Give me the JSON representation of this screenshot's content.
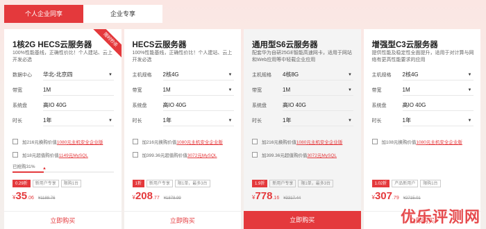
{
  "tabs": [
    "个人企业同享",
    "企业专享"
  ],
  "cards": [
    {
      "title": "1核2G HECS云服务器",
      "desc": "100%性能基线，正确性价比！个人建站、云上开发必选",
      "ribbon": "限时秒杀",
      "rows": [
        {
          "label": "数据中心",
          "value": "华北-北京四",
          "dropdown": true
        },
        {
          "label": "带宽",
          "value": "1M",
          "dropdown": false
        },
        {
          "label": "系统盘",
          "value": "高IO 40G",
          "dropdown": false
        },
        {
          "label": "时长",
          "value": "1年",
          "dropdown": true
        }
      ],
      "checks": [
        {
          "pre": "加216元换购价值",
          "hl": "1080元主机安全企业版"
        },
        {
          "pre": "加18元超值购价值",
          "hl": "1149元MySQL"
        }
      ],
      "progress_text": "已抢购31%",
      "progress": 0.31,
      "tags": [
        "0.29折",
        "新用户专享",
        "限购1台"
      ],
      "price": {
        "currency": "¥",
        "int": "35",
        "dec": ".06",
        "orig": "¥1188.76"
      },
      "buy": "立即购买"
    },
    {
      "title": "HECS云服务器",
      "desc": "100%性能基线，正确性价比！个人建站、云上开发必选",
      "rows": [
        {
          "label": "主机规格",
          "value": "2核4G",
          "dropdown": true
        },
        {
          "label": "带宽",
          "value": "1M",
          "dropdown": true
        },
        {
          "label": "系统盘",
          "value": "高IO 40G",
          "dropdown": false
        },
        {
          "label": "时长",
          "value": "1年",
          "dropdown": true
        }
      ],
      "checks": [
        {
          "pre": "加216元换购价值",
          "hl": "1080元主机安全企业版"
        },
        {
          "pre": "加399.36元超值购价值",
          "hl": "3072元MySQL"
        }
      ],
      "tags": [
        "1折",
        "新用户专享",
        "限1单，最多3台"
      ],
      "price": {
        "currency": "¥",
        "int": "208",
        "dec": ".77",
        "orig": "¥1878.99"
      },
      "buy": "立即购买"
    },
    {
      "title": "通用型S6云服务器",
      "desc": "配套华为自研25GE智能高速网卡，适用于网站和Web应用等中轻载企业应用",
      "rows": [
        {
          "label": "主机规格",
          "value": "4核8G",
          "dropdown": true
        },
        {
          "label": "带宽",
          "value": "1M",
          "dropdown": true
        },
        {
          "label": "系统盘",
          "value": "高IO 40G",
          "dropdown": false
        },
        {
          "label": "时长",
          "value": "1年",
          "dropdown": true
        }
      ],
      "checks": [
        {
          "pre": "加216元换购价值",
          "hl": "1080元主机安全企业版"
        },
        {
          "pre": "加399.36元超值购价值",
          "hl": "3072元MySQL"
        }
      ],
      "tags": [
        "1.9折",
        "新用户专享",
        "限1单，最多3台"
      ],
      "price": {
        "currency": "¥",
        "int": "778",
        "dec": ".16",
        "orig": "¥3317.44"
      },
      "buy": "立即购买"
    },
    {
      "title": "增强型C3云服务器",
      "desc": "提供性能及稳定性全面提升，适用于对计算与网络有更高性能要求的应用",
      "rows": [
        {
          "label": "主机规格",
          "value": "2核4G",
          "dropdown": true
        },
        {
          "label": "带宽",
          "value": "1M",
          "dropdown": true
        },
        {
          "label": "系统盘",
          "value": "高IO 40G",
          "dropdown": false
        },
        {
          "label": "时长",
          "value": "1年",
          "dropdown": true
        }
      ],
      "checks": [
        {
          "pre": "加108元换购价值",
          "hl": "1080元主机安全企业版"
        }
      ],
      "tags": [
        "1.02折",
        "产品新用户",
        "限购1台"
      ],
      "price": {
        "currency": "¥",
        "int": "307",
        "dec": ".79",
        "orig": "¥2715.01"
      },
      "buy": "立即购买"
    }
  ],
  "watermark": "优乐评测网",
  "accent": "#e4393c"
}
